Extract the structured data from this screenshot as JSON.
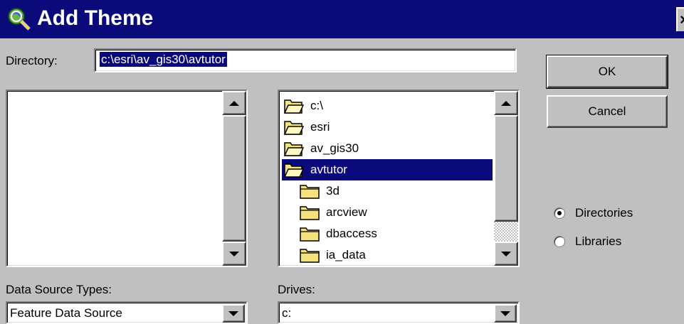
{
  "window": {
    "title": "Add Theme",
    "close_glyph": "×",
    "title_bar_color": "#0a0a7a",
    "title_icon": "globe-magnifier-icon"
  },
  "directory": {
    "label": "Directory:",
    "value": "c:\\esri\\av_gis30\\avtutor"
  },
  "buttons": {
    "ok": "OK",
    "cancel": "Cancel"
  },
  "file_list": {
    "items": []
  },
  "dir_list": {
    "items": [
      {
        "label": "c:\\",
        "icon": "open-folder-icon",
        "selected": false
      },
      {
        "label": "esri",
        "icon": "open-folder-icon",
        "selected": false
      },
      {
        "label": "av_gis30",
        "icon": "open-folder-icon",
        "selected": false
      },
      {
        "label": "avtutor",
        "icon": "open-folder-icon",
        "selected": true
      },
      {
        "label": "3d",
        "icon": "folder-icon",
        "selected": false
      },
      {
        "label": "arcview",
        "icon": "folder-icon",
        "selected": false
      },
      {
        "label": "dbaccess",
        "icon": "folder-icon",
        "selected": false
      },
      {
        "label": "ia_data",
        "icon": "folder-icon",
        "selected": false
      }
    ]
  },
  "data_source_types": {
    "label": "Data Source Types:",
    "value": "Feature Data Source"
  },
  "drives": {
    "label": "Drives:",
    "value": "c:"
  },
  "view_mode": {
    "options": [
      {
        "label": "Directories",
        "checked": true
      },
      {
        "label": "Libraries",
        "checked": false
      }
    ]
  }
}
